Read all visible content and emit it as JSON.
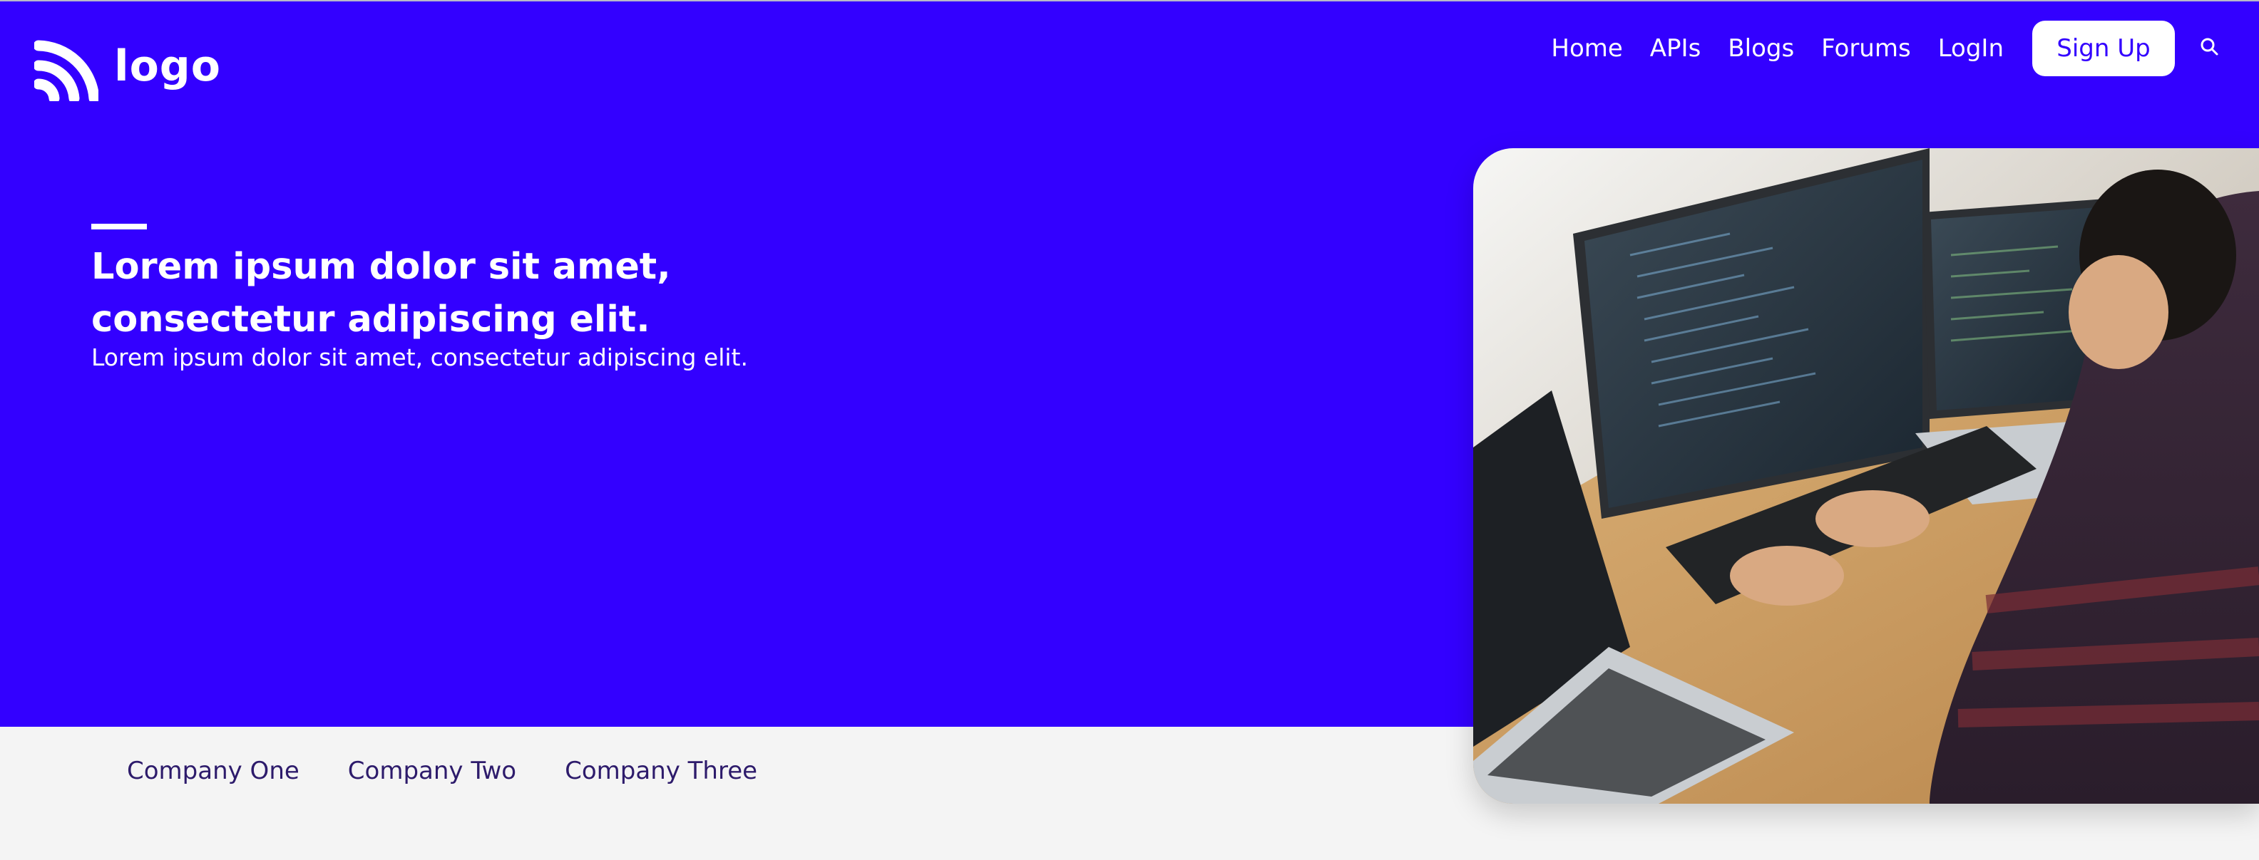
{
  "header": {
    "logo_text": "logo",
    "nav": [
      "Home",
      "APIs",
      "Blogs",
      "Forums",
      "LogIn"
    ],
    "signup_label": "Sign Up",
    "search_icon": "search-icon"
  },
  "hero": {
    "title": "Lorem ipsum dolor sit amet, consectetur adipiscing elit.",
    "subtitle": "Lorem ipsum dolor sit amet, consectetur adipiscing elit."
  },
  "companies": [
    "Company One",
    "Company Two",
    "Company Three"
  ],
  "colors": {
    "brand": "#3300ff",
    "footer_bg": "#f4f4f4",
    "company_text": "#2d1b6b",
    "white": "#ffffff"
  }
}
